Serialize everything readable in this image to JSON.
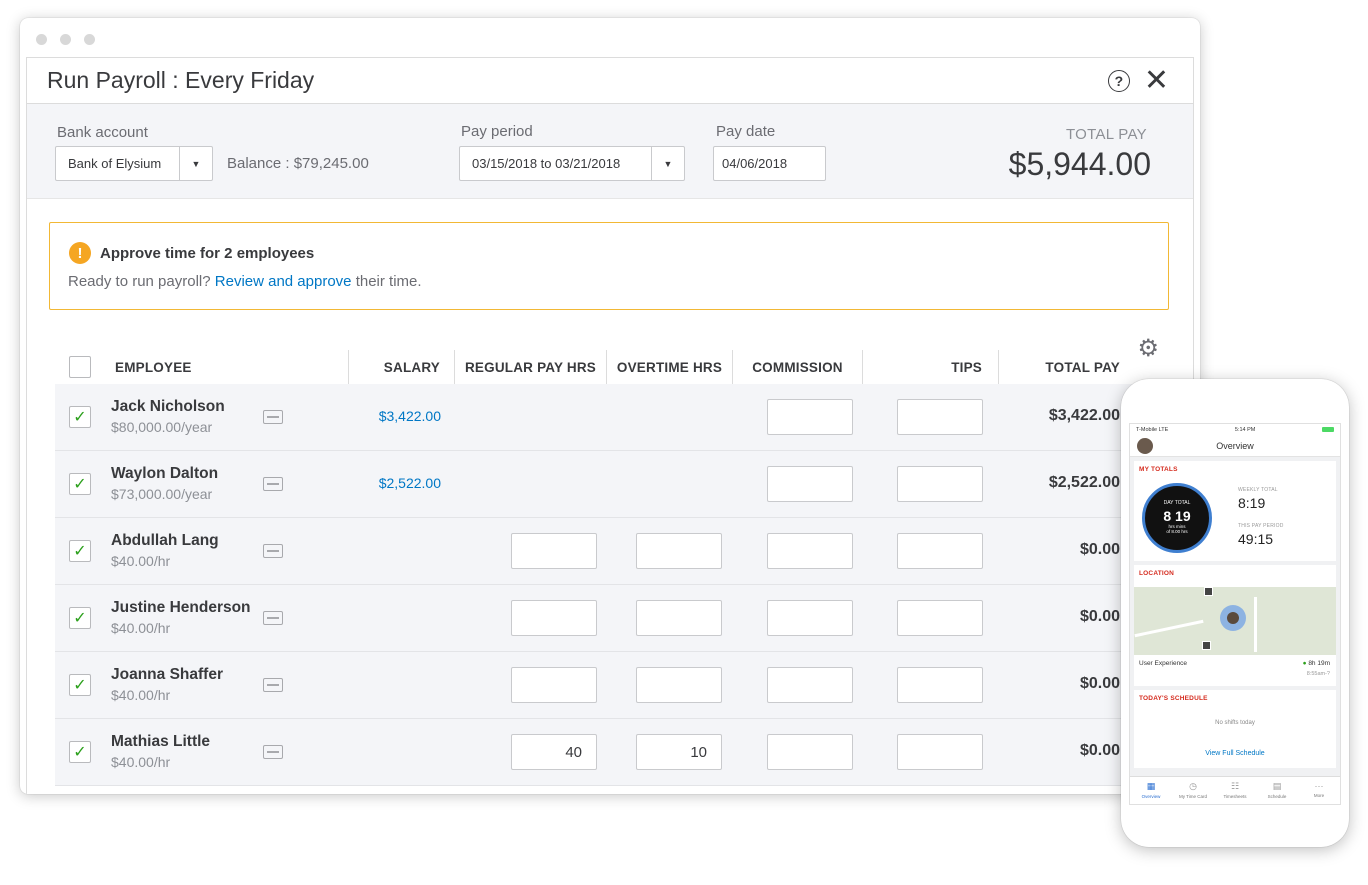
{
  "window": {
    "title": "Run Payroll : Every Friday",
    "help_icon": "?",
    "close_icon": "✕"
  },
  "header": {
    "bank_account_label": "Bank account",
    "bank_account_value": "Bank of Elysium",
    "balance": "Balance : $79,245.00",
    "pay_period_label": "Pay period",
    "pay_period_value": "03/15/2018 to 03/21/2018",
    "pay_date_label": "Pay date",
    "pay_date_value": "04/06/2018",
    "total_pay_label": "TOTAL PAY",
    "total_pay_value": "$5,944.00"
  },
  "alert": {
    "icon": "!",
    "title": "Approve time for 2 employees",
    "text_before": "Ready to run payroll?",
    "link": "Review and approve",
    "text_after": "their time.",
    "accent": "#f2b835"
  },
  "table": {
    "columns": [
      "EMPLOYEE",
      "SALARY",
      "REGULAR PAY HRS",
      "OVERTIME HRS",
      "COMMISSION",
      "TIPS",
      "TOTAL PAY"
    ],
    "rows": [
      {
        "name": "Jack Nicholson",
        "rate": "$80,000.00/year",
        "salary": "$3,422.00",
        "regular": null,
        "overtime": null,
        "commission": "",
        "tips": "",
        "total": "$3,422.00"
      },
      {
        "name": "Waylon Dalton",
        "rate": "$73,000.00/year",
        "salary": "$2,522.00",
        "regular": null,
        "overtime": null,
        "commission": "",
        "tips": "",
        "total": "$2,522.00"
      },
      {
        "name": "Abdullah Lang",
        "rate": "$40.00/hr",
        "salary": "",
        "regular": "",
        "overtime": "",
        "commission": "",
        "tips": "",
        "total": "$0.00"
      },
      {
        "name": "Justine Henderson",
        "rate": "$40.00/hr",
        "salary": "",
        "regular": "",
        "overtime": "",
        "commission": "",
        "tips": "",
        "total": "$0.00"
      },
      {
        "name": "Joanna Shaffer",
        "rate": "$40.00/hr",
        "salary": "",
        "regular": "",
        "overtime": "",
        "commission": "",
        "tips": "",
        "total": "$0.00"
      },
      {
        "name": "Mathias Little",
        "rate": "$40.00/hr",
        "salary": "",
        "regular": "40",
        "overtime": "10",
        "commission": "",
        "tips": "",
        "total": "$0.00"
      }
    ],
    "checked_icon": "✓"
  },
  "phone": {
    "carrier": "T-Mobile  LTE",
    "time": "5:14 PM",
    "nav_title": "Overview",
    "my_totals_label": "MY TOTALS",
    "day_total_label": "DAY TOTAL",
    "day_total_value": "8  19",
    "day_total_units": "hrs    mins",
    "day_total_of": "of 8.00 hrs",
    "weekly_total_label": "WEEKLY TOTAL",
    "weekly_total_value": "8:19",
    "pay_period_label": "THIS PAY PERIOD",
    "pay_period_value": "49:15",
    "location_label": "LOCATION",
    "location_name": "User Experience",
    "location_time": "8h 19m",
    "location_since": "8:55am-?",
    "schedule_label": "TODAY'S SCHEDULE",
    "no_shifts": "No shifts today",
    "view_schedule": "View Full Schedule",
    "tabs": [
      "Overview",
      "My Time Card",
      "Timesheets",
      "Schedule",
      "More"
    ],
    "tab_icons": [
      "▦",
      "◷",
      "☷",
      "▤",
      "···"
    ]
  }
}
